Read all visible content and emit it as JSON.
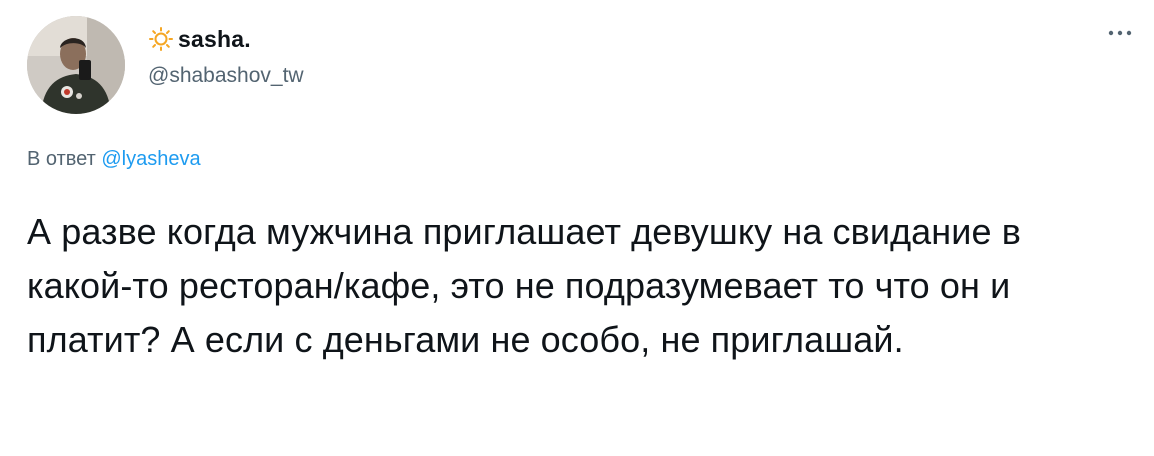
{
  "author": {
    "display_name": "sasha.",
    "handle": "@shabashov_tw",
    "name_emoji_icon": "sun-icon"
  },
  "reply": {
    "prefix": "В ответ",
    "mention": "@lyasheva"
  },
  "tweet": {
    "text": "А разве когда мужчина приглашает девушку на свидание в какой-то ресторан/кафе, это не подразумевает то что он и платит? А если с деньгами не особо, не приглашай."
  },
  "colors": {
    "link": "#1d9bf0",
    "secondary_text": "#536471",
    "primary_text": "#0f1419",
    "sun": "#f5a623"
  }
}
